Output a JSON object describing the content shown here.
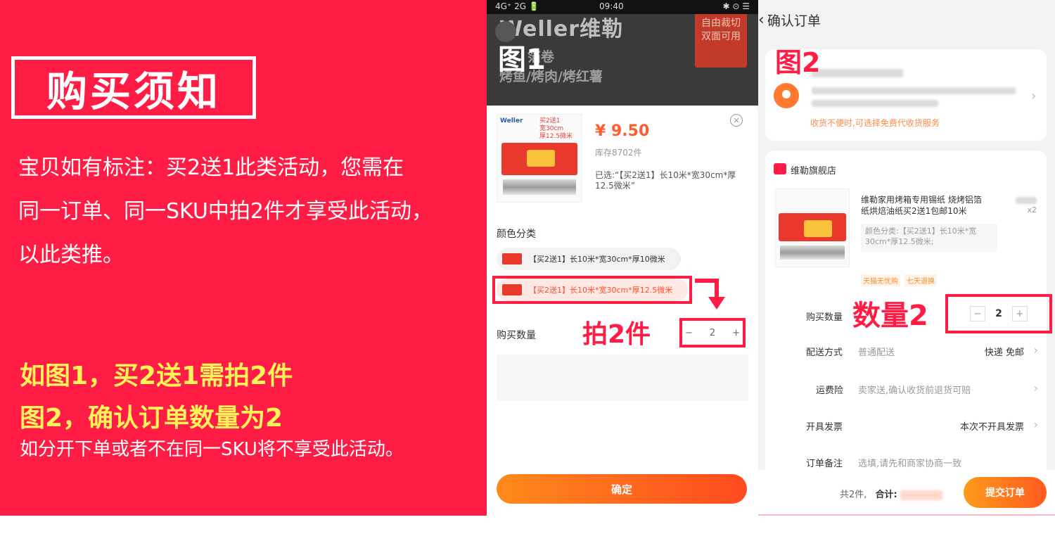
{
  "notice": {
    "title": "购买须知",
    "body_lines": [
      "宝贝如有标注：买2送1此类活动，您需在",
      "同一订单、同一SKU中拍2件才享受此活动，",
      "以此类推。"
    ],
    "highlight_lines": [
      "如图1，买2送1需拍2件",
      "图2，确认订单数量为2"
    ],
    "footer": "如分开下单或者不在同一SKU将不享受此活动。"
  },
  "fig1": {
    "status": {
      "signal": "4G⁺ 2G 🔋",
      "time": "09:40",
      "right": "✱ ⊙ ☰"
    },
    "label": "图1",
    "brand": "Weller维勒",
    "banner_sub1": "箔卷",
    "banner_sub2": "烤鱼/烤肉/烤红薯",
    "banner_tag": "自由裁切\n双面可用",
    "product_brand": "Weller",
    "product_tag": "买2送1\n宽30cm\n厚12.5微米",
    "price": "¥ 9.50",
    "stock": "库存8702件",
    "selected": "已选:“【买2送1】长10米*宽30cm*厚12.5微米”",
    "color_label": "颜色分类",
    "options": [
      "【买2送1】长10米*宽30cm*厚10微米",
      "【买2送1】长10米*宽30cm*厚12.5微米"
    ],
    "qty_label": "购买数量",
    "annotation": "拍2件",
    "qty": {
      "minus": "−",
      "value": "2",
      "plus": "+"
    },
    "confirm": "确定",
    "colors": {
      "accent": "#ff1d46",
      "button": "#ff5a1f"
    }
  },
  "fig2": {
    "header": "确认订单",
    "label": "图2",
    "addr_note": "收货不便时,可选择免费代收货服务",
    "store": "维勒旗舰店",
    "product_name": "维勒家用烤箱专用锡纸 烧烤铝箔纸烘焙油纸买2送1包邮10米",
    "product_attr": "颜色分类:【买2送1】长10米*宽30cm*厚12.5微米;",
    "qty_mark": "x2",
    "tags": [
      "天猫无忧购",
      "七天退换"
    ],
    "rows": {
      "qty": {
        "label": "购买数量"
      },
      "delivery": {
        "label": "配送方式",
        "value": "普通配送",
        "right": "快递 免邮"
      },
      "insurance": {
        "label": "运费险",
        "value": "卖家送,确认收货前退货可赔"
      },
      "invoice": {
        "label": "开具发票",
        "right": "本次不开具发票"
      },
      "note": {
        "label": "订单备注",
        "value": "选填,请先和商家协商一致"
      }
    },
    "annotation": "数量2",
    "qty": {
      "minus": "−",
      "value": "2",
      "plus": "+"
    },
    "total_count": "共2件,",
    "total_label": "合计:",
    "submit": "提交订单"
  }
}
